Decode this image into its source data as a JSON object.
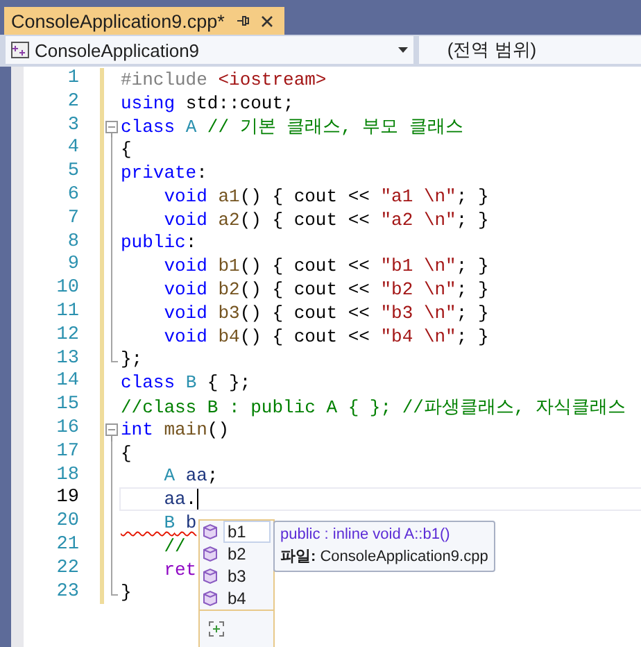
{
  "tab": {
    "title": "ConsoleApplication9.cpp*",
    "selected": true
  },
  "navigation": {
    "project": "ConsoleApplication9",
    "scope": "(전역 범위)"
  },
  "lines": [
    {
      "number": "1",
      "changed": true,
      "kind": "plain",
      "current": false,
      "tokens": [
        {
          "kind": "preproc",
          "text": "#include"
        },
        {
          "kind": "string",
          "text": " <iostream>"
        }
      ]
    },
    {
      "number": "2",
      "changed": true,
      "kind": "plain",
      "current": false,
      "tokens": [
        {
          "kind": "keyword",
          "text": "using"
        },
        {
          "kind": "plain",
          "text": " std::cout;"
        }
      ]
    },
    {
      "number": "3",
      "changed": true,
      "kind": "fold",
      "current": false,
      "tokens": [
        {
          "kind": "keyword",
          "text": "class"
        },
        {
          "kind": "type",
          "text": " A"
        },
        {
          "kind": "comment",
          "text": " // 기본 클래스, 부모 클래스"
        }
      ]
    },
    {
      "number": "4",
      "changed": true,
      "kind": "block",
      "current": false,
      "tokens": [
        {
          "kind": "plain",
          "text": "{"
        }
      ]
    },
    {
      "number": "5",
      "changed": true,
      "kind": "block",
      "current": false,
      "tokens": [
        {
          "kind": "keyword",
          "text": "private"
        },
        {
          "kind": "plain",
          "text": ":"
        }
      ]
    },
    {
      "number": "6",
      "changed": true,
      "kind": "block",
      "current": false,
      "tokens": [
        {
          "kind": "keyword",
          "text": "    void"
        },
        {
          "kind": "function",
          "text": " a1"
        },
        {
          "kind": "plain",
          "text": "() { cout << "
        },
        {
          "kind": "string",
          "text": "\"a1 \\n\""
        },
        {
          "kind": "plain",
          "text": "; }"
        }
      ]
    },
    {
      "number": "7",
      "changed": true,
      "kind": "block",
      "current": false,
      "tokens": [
        {
          "kind": "keyword",
          "text": "    void"
        },
        {
          "kind": "function",
          "text": " a2"
        },
        {
          "kind": "plain",
          "text": "() { cout << "
        },
        {
          "kind": "string",
          "text": "\"a2 \\n\""
        },
        {
          "kind": "plain",
          "text": "; }"
        }
      ]
    },
    {
      "number": "8",
      "changed": true,
      "kind": "block",
      "current": false,
      "tokens": [
        {
          "kind": "keyword",
          "text": "public"
        },
        {
          "kind": "plain",
          "text": ":"
        }
      ]
    },
    {
      "number": "9",
      "changed": true,
      "kind": "block",
      "current": false,
      "tokens": [
        {
          "kind": "keyword",
          "text": "    void"
        },
        {
          "kind": "function",
          "text": " b1"
        },
        {
          "kind": "plain",
          "text": "() { cout << "
        },
        {
          "kind": "string",
          "text": "\"b1 \\n\""
        },
        {
          "kind": "plain",
          "text": "; }"
        }
      ]
    },
    {
      "number": "10",
      "changed": true,
      "kind": "block",
      "current": false,
      "tokens": [
        {
          "kind": "keyword",
          "text": "    void"
        },
        {
          "kind": "function",
          "text": " b2"
        },
        {
          "kind": "plain",
          "text": "() { cout << "
        },
        {
          "kind": "string",
          "text": "\"b2 \\n\""
        },
        {
          "kind": "plain",
          "text": "; }"
        }
      ]
    },
    {
      "number": "11",
      "changed": true,
      "kind": "block",
      "current": false,
      "tokens": [
        {
          "kind": "keyword",
          "text": "    void"
        },
        {
          "kind": "function",
          "text": " b3"
        },
        {
          "kind": "plain",
          "text": "() { cout << "
        },
        {
          "kind": "string",
          "text": "\"b3 \\n\""
        },
        {
          "kind": "plain",
          "text": "; }"
        }
      ]
    },
    {
      "number": "12",
      "changed": true,
      "kind": "block",
      "current": false,
      "tokens": [
        {
          "kind": "keyword",
          "text": "    void"
        },
        {
          "kind": "function",
          "text": " b4"
        },
        {
          "kind": "plain",
          "text": "() { cout << "
        },
        {
          "kind": "string",
          "text": "\"b4 \\n\""
        },
        {
          "kind": "plain",
          "text": "; }"
        }
      ]
    },
    {
      "number": "13",
      "changed": true,
      "kind": "block-end",
      "current": false,
      "tokens": [
        {
          "kind": "plain",
          "text": "};"
        }
      ]
    },
    {
      "number": "14",
      "changed": true,
      "kind": "plain",
      "current": false,
      "tokens": [
        {
          "kind": "keyword",
          "text": "class"
        },
        {
          "kind": "type",
          "text": " B"
        },
        {
          "kind": "plain",
          "text": " { };"
        }
      ]
    },
    {
      "number": "15",
      "changed": true,
      "kind": "plain",
      "current": false,
      "tokens": [
        {
          "kind": "comment",
          "text": "//class B : public A { }; //파생클래스, 자식클래스"
        }
      ]
    },
    {
      "number": "16",
      "changed": true,
      "kind": "fold",
      "current": false,
      "tokens": [
        {
          "kind": "keyword",
          "text": "int"
        },
        {
          "kind": "function",
          "text": " main"
        },
        {
          "kind": "plain",
          "text": "()"
        }
      ]
    },
    {
      "number": "17",
      "changed": true,
      "kind": "block",
      "current": false,
      "tokens": [
        {
          "kind": "plain",
          "text": "{"
        }
      ]
    },
    {
      "number": "18",
      "changed": true,
      "kind": "block",
      "current": false,
      "tokens": [
        {
          "kind": "type",
          "text": "    A"
        },
        {
          "kind": "variable",
          "text": " aa"
        },
        {
          "kind": "plain",
          "text": ";"
        }
      ]
    },
    {
      "number": "19",
      "changed": true,
      "kind": "block",
      "current": true,
      "tokens": [
        {
          "kind": "variable",
          "text": "    aa"
        },
        {
          "kind": "plain",
          "text": "."
        }
      ]
    },
    {
      "number": "20",
      "changed": true,
      "kind": "block",
      "current": false,
      "tokens": [
        {
          "kind": "error-type",
          "text": "    B"
        },
        {
          "kind": "error-variable",
          "text": " b"
        }
      ]
    },
    {
      "number": "21",
      "changed": true,
      "kind": "block",
      "current": false,
      "tokens": [
        {
          "kind": "comment",
          "text": "    //"
        }
      ]
    },
    {
      "number": "22",
      "changed": true,
      "kind": "block",
      "current": false,
      "tokens": [
        {
          "kind": "control",
          "text": "    ret"
        }
      ]
    },
    {
      "number": "23",
      "changed": true,
      "kind": "block-end",
      "current": false,
      "tokens": [
        {
          "kind": "plain",
          "text": "}"
        }
      ]
    }
  ],
  "completion": {
    "items": [
      {
        "label": "b1",
        "selected": true
      },
      {
        "label": "b2",
        "selected": false
      },
      {
        "label": "b3",
        "selected": false
      },
      {
        "label": "b4",
        "selected": false
      }
    ],
    "tooltip": {
      "signature": "public : inline void A::b1()",
      "file": "**파일:** ConsoleApplication9.cpp"
    }
  }
}
